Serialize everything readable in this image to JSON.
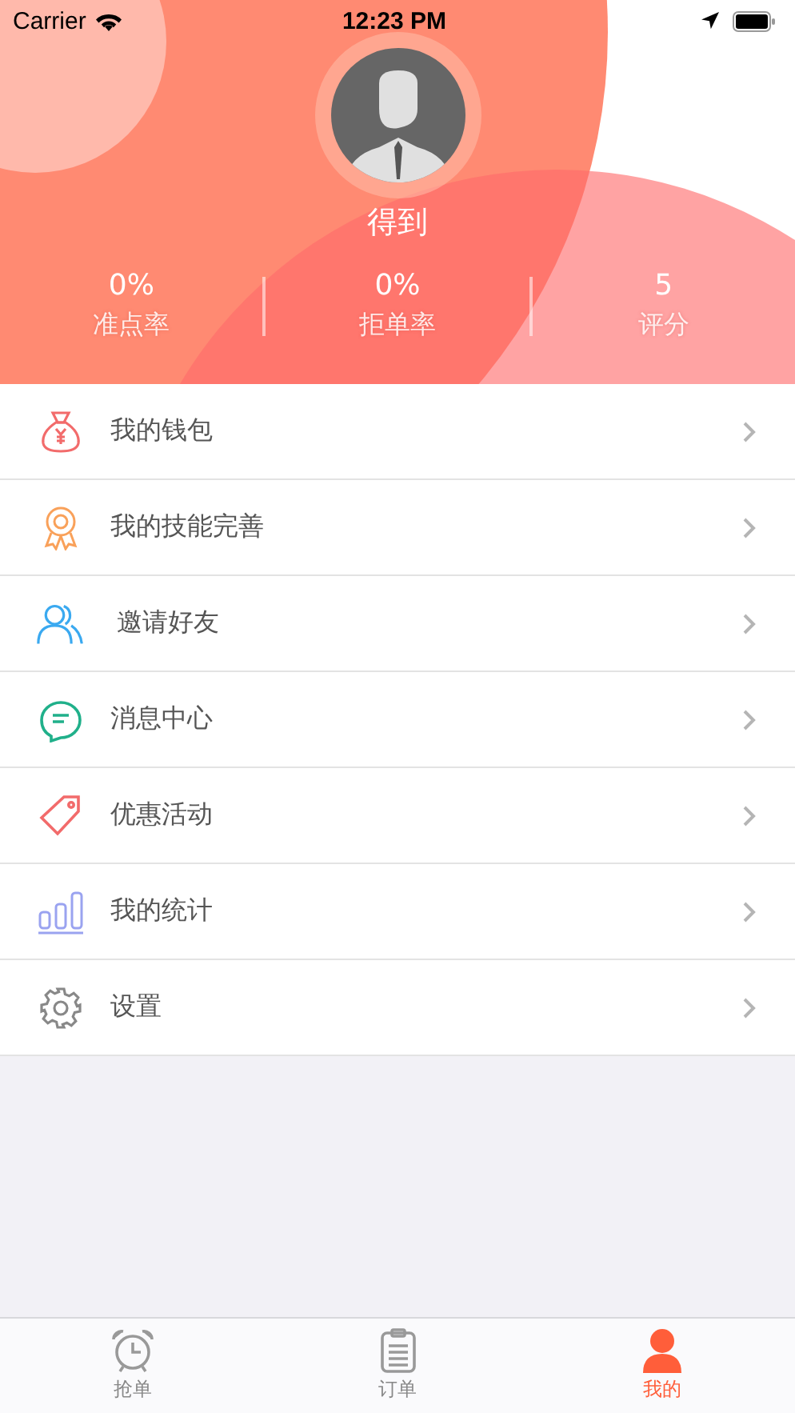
{
  "status_bar": {
    "carrier": "Carrier",
    "time": "12:23 PM"
  },
  "profile": {
    "name": "得到"
  },
  "stats": [
    {
      "value": "0%",
      "label": "准点率"
    },
    {
      "value": "0%",
      "label": "拒单率"
    },
    {
      "value": "5",
      "label": "评分"
    }
  ],
  "menu": [
    {
      "label": "我的钱包"
    },
    {
      "label": "我的技能完善"
    },
    {
      "label": "邀请好友"
    },
    {
      "label": "消息中心"
    },
    {
      "label": "优惠活动"
    },
    {
      "label": "我的统计"
    },
    {
      "label": "设置"
    }
  ],
  "tabs": [
    {
      "label": "抢单",
      "selected": false
    },
    {
      "label": "订单",
      "selected": false
    },
    {
      "label": "我的",
      "selected": true
    }
  ]
}
